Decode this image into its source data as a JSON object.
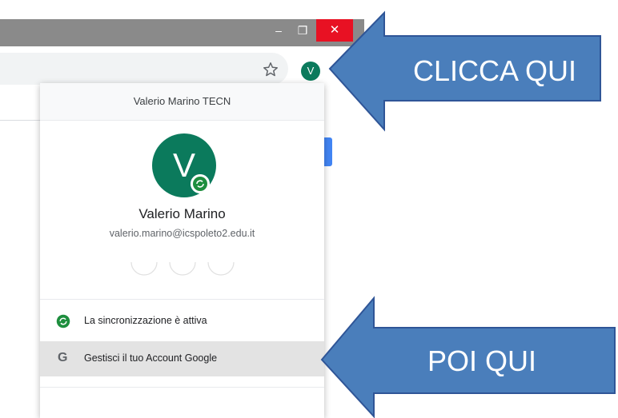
{
  "window": {
    "minimize_glyph": "–",
    "restore_glyph": "❐",
    "close_glyph": "✕"
  },
  "toolbar": {
    "bookmark_icon": "star-icon",
    "avatar_letter": "V"
  },
  "profile_menu": {
    "header": "Valerio Marino TECN",
    "avatar_letter": "V",
    "name": "Valerio Marino",
    "email": "valerio.marino@icspoleto2.edu.it",
    "sync_label": "La sincronizzazione è attiva",
    "account_icon_glyph": "G",
    "manage_account_label": "Gestisci il tuo Account Google"
  },
  "annotations": {
    "arrow1_label": "CLICCA QUI",
    "arrow2_label": "POI QUI"
  },
  "colors": {
    "accent_blue": "#4a7ebb",
    "avatar_green": "#0b7a5c",
    "close_red": "#e81123",
    "sync_green": "#1e8e3e"
  }
}
